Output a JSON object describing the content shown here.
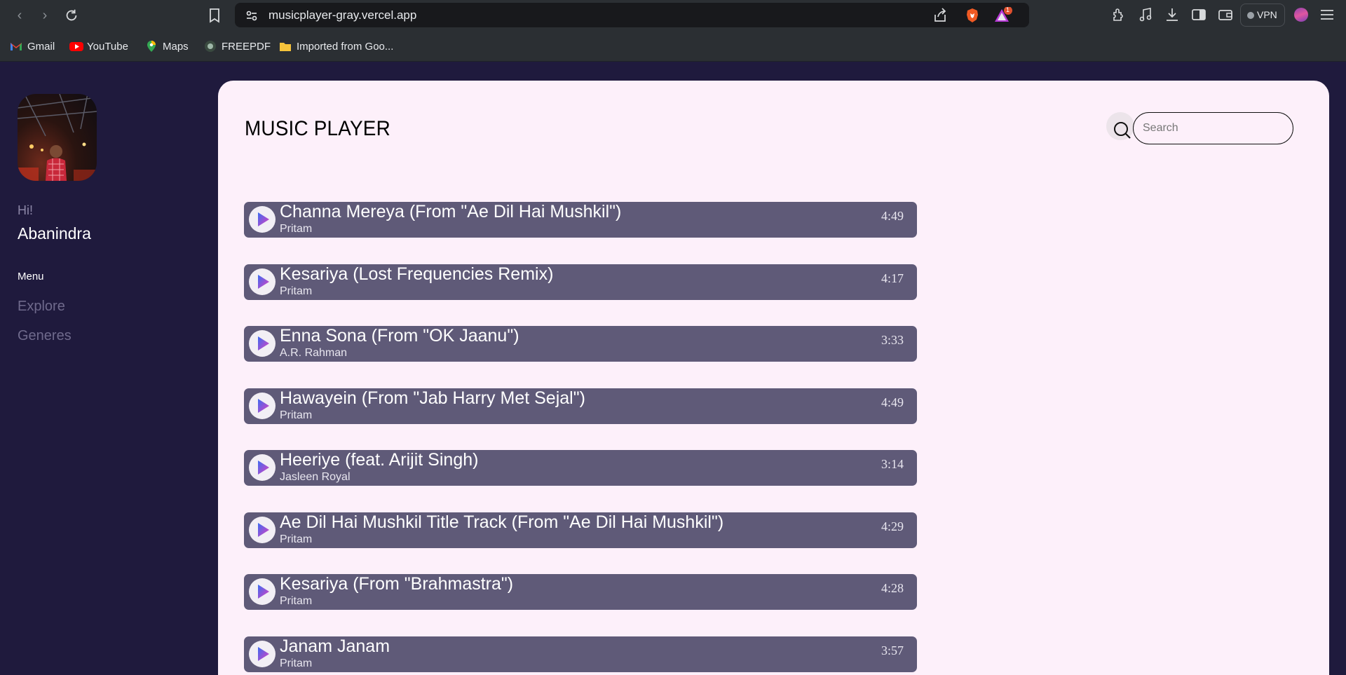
{
  "browser": {
    "url": "musicplayer-gray.vercel.app",
    "vpn_label": "VPN",
    "notification_count": "1",
    "bookmarks": [
      {
        "label": "Gmail",
        "icon": "gmail-icon"
      },
      {
        "label": "YouTube",
        "icon": "youtube-icon"
      },
      {
        "label": "Maps",
        "icon": "maps-icon"
      },
      {
        "label": "FREEPDF",
        "icon": "freepdf-icon"
      },
      {
        "label": "Imported from Goo...",
        "icon": "folder-icon"
      }
    ]
  },
  "sidebar": {
    "greeting": "Hi!",
    "username": "Abanindra",
    "menu_label": "Menu",
    "menu_items": [
      {
        "label": "Explore"
      },
      {
        "label": "Generes"
      }
    ]
  },
  "main": {
    "title": "MUSIC PLAYER",
    "search_placeholder": "Search",
    "songs": [
      {
        "title": "Channa Mereya (From \"Ae Dil Hai Mushkil\")",
        "artist": "Pritam",
        "duration": "4:49"
      },
      {
        "title": "Kesariya (Lost Frequencies Remix)",
        "artist": "Pritam",
        "duration": "4:17"
      },
      {
        "title": "Enna Sona (From \"OK Jaanu\")",
        "artist": "A.R. Rahman",
        "duration": "3:33"
      },
      {
        "title": "Hawayein (From \"Jab Harry Met Sejal\")",
        "artist": "Pritam",
        "duration": "4:49"
      },
      {
        "title": "Heeriye (feat. Arijit Singh)",
        "artist": "Jasleen Royal",
        "duration": "3:14"
      },
      {
        "title": "Ae Dil Hai Mushkil Title Track (From \"Ae Dil Hai Mushkil\")",
        "artist": "Pritam",
        "duration": "4:29"
      },
      {
        "title": "Kesariya (From \"Brahmastra\")",
        "artist": "Pritam",
        "duration": "4:28"
      },
      {
        "title": "Janam Janam",
        "artist": "Pritam",
        "duration": "3:57"
      }
    ]
  },
  "colors": {
    "page_background": "#1f1a3d",
    "panel_background": "#fdf0fa",
    "song_row": "#5f5a78",
    "play_gradient_start": "#3b6cf0",
    "play_gradient_end": "#e040c0"
  }
}
